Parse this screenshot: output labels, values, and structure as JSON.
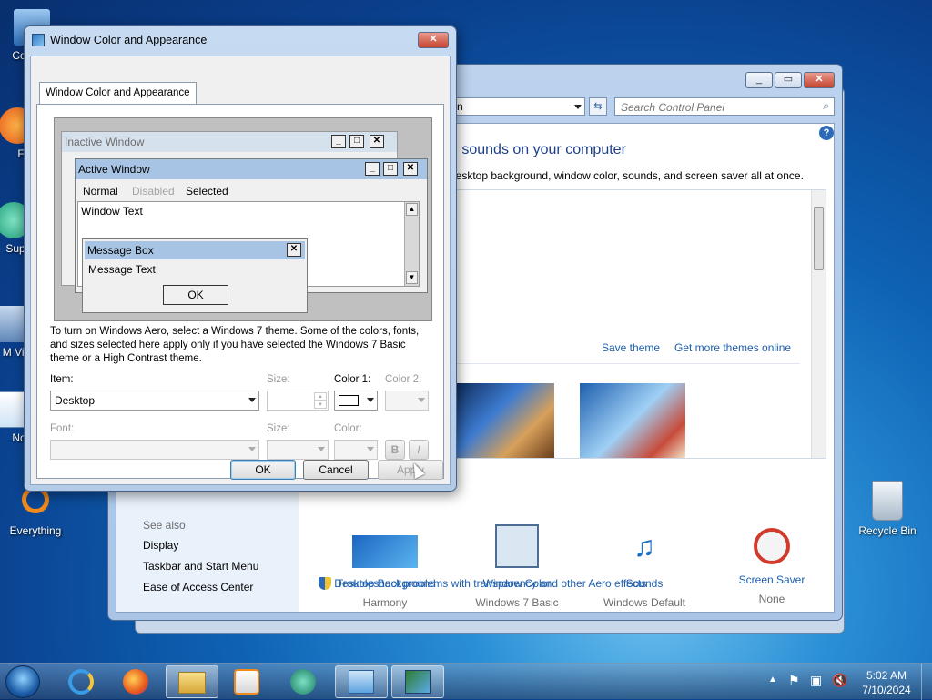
{
  "desktop": {
    "icons": [
      {
        "label": "Co"
      },
      {
        "label": "F"
      },
      {
        "label": "Sup"
      },
      {
        "label": "M Visu"
      },
      {
        "label": "No"
      },
      {
        "label": "Everything"
      },
      {
        "label": "Recycle Bin"
      }
    ]
  },
  "control_panel": {
    "address_tail": "n",
    "search_placeholder": "Search Control Panel",
    "heading": "d sounds on your computer",
    "subheading": "desktop background, window color, sounds, and screen saver all at once.",
    "save_theme": "Save theme",
    "get_more_themes": "Get more themes online",
    "see_also": "See also",
    "see_also_links": [
      "Display",
      "Taskbar and Start Menu",
      "Ease of Access Center"
    ],
    "settings": [
      {
        "title": "Desktop Background",
        "value": "Harmony"
      },
      {
        "title": "Window Color",
        "value": "Windows 7 Basic"
      },
      {
        "title": "Sounds",
        "value": "Windows Default"
      },
      {
        "title": "Screen Saver",
        "value": "None"
      }
    ],
    "troubleshoot": "Troubleshoot problems with transparency and other Aero effects"
  },
  "dialog": {
    "title": "Window Color and Appearance",
    "tab": "Window Color and Appearance",
    "preview": {
      "inactive_window": "Inactive Window",
      "active_window": "Active Window",
      "menu_normal": "Normal",
      "menu_disabled": "Disabled",
      "menu_selected": "Selected",
      "window_text": "Window Text",
      "message_box": "Message Box",
      "message_text": "Message Text",
      "ok": "OK"
    },
    "description": "To turn on Windows Aero, select a Windows 7 theme.  Some of the colors, fonts, and sizes selected here apply only if you have selected the Windows 7 Basic theme or a High Contrast theme.",
    "item_label": "Item:",
    "item_value": "Desktop",
    "size_label": "Size:",
    "color1_label": "Color 1:",
    "color2_label": "Color 2:",
    "font_label": "Font:",
    "font_size_label": "Size:",
    "font_color_label": "Color:",
    "bold": "B",
    "italic": "I",
    "ok": "OK",
    "cancel": "Cancel",
    "apply": "Apply"
  },
  "taskbar": {
    "time": "5:02 AM",
    "date": "7/10/2024"
  },
  "colors": {
    "accent": "#1e5fae",
    "title_bar_active": "#9fb9dc",
    "close_red": "#c4442e"
  }
}
